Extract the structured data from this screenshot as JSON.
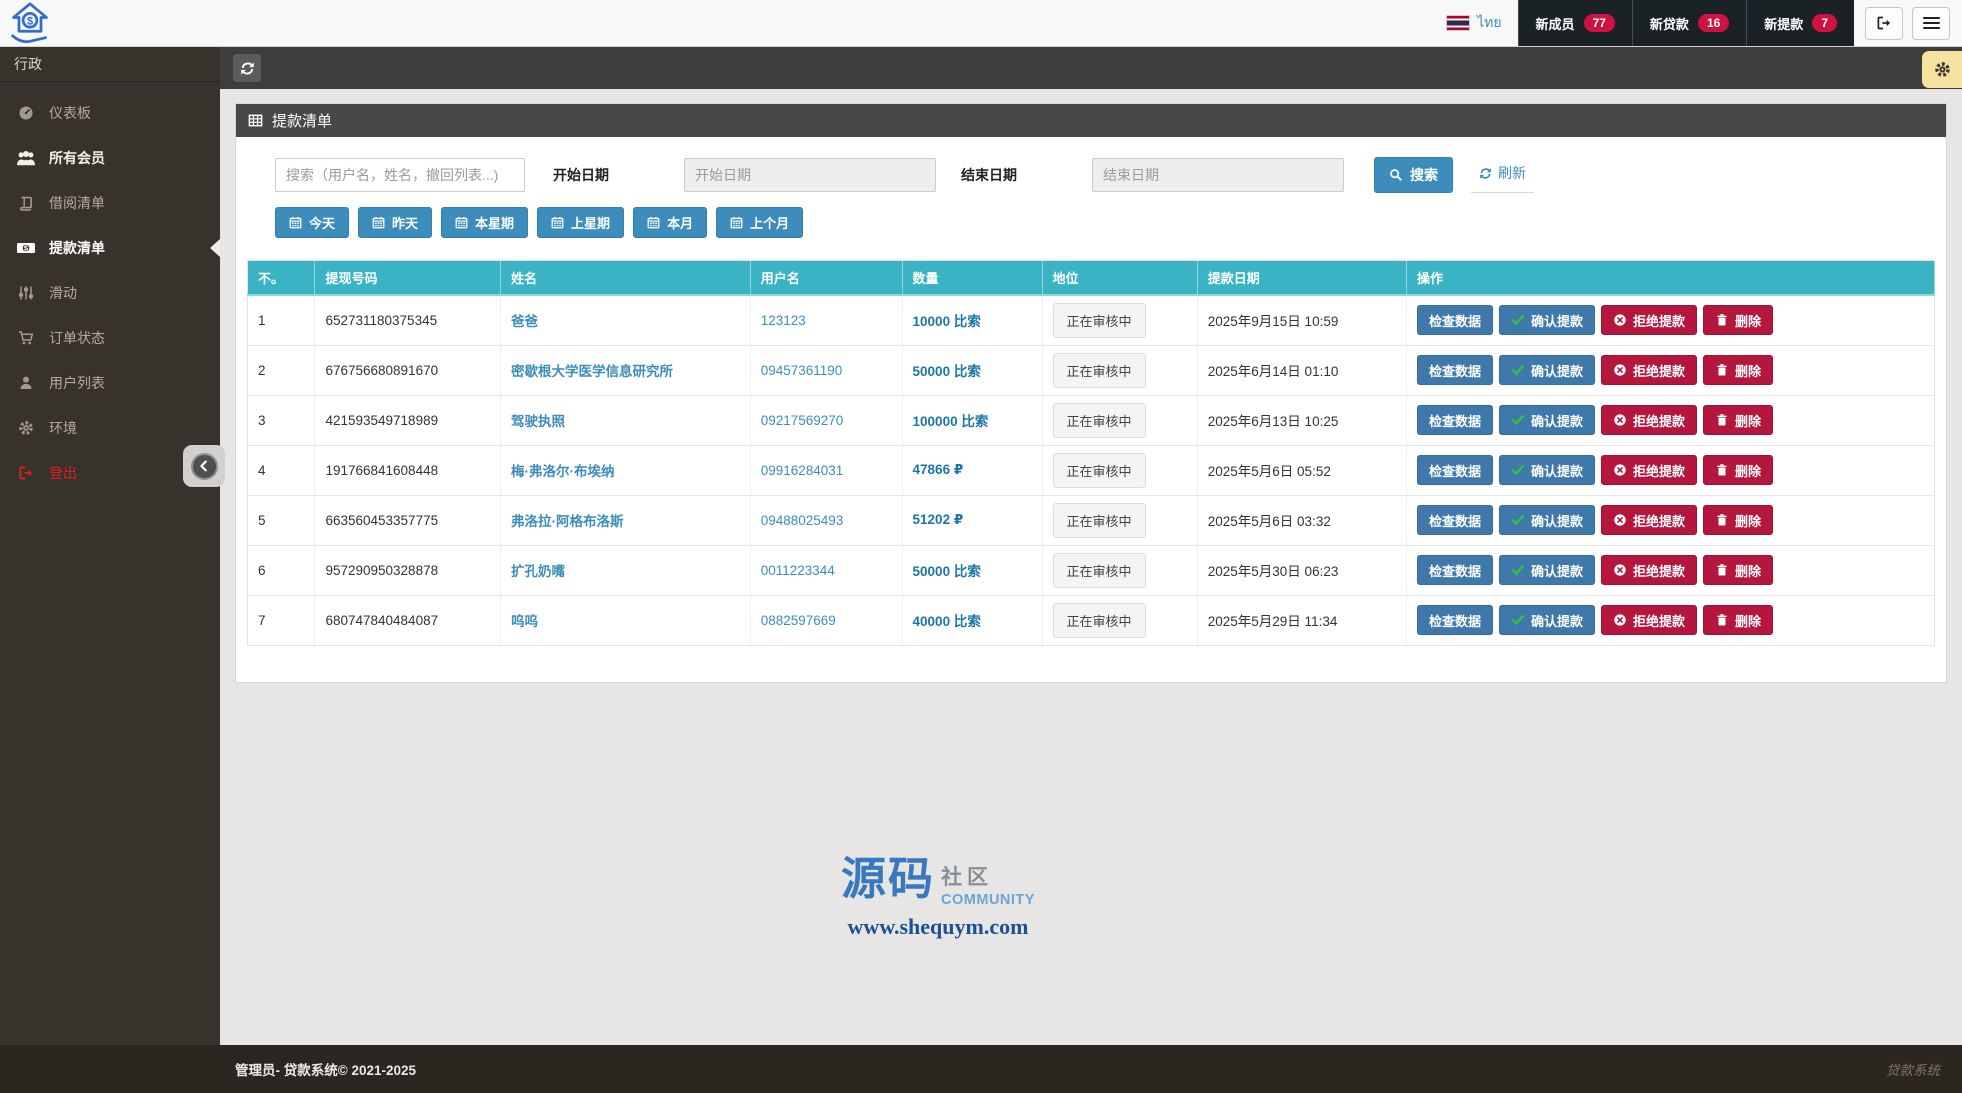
{
  "topbar": {
    "lang": "ไทย",
    "nav": [
      {
        "label": "新成员",
        "count": "77"
      },
      {
        "label": "新贷款",
        "count": "16"
      },
      {
        "label": "新提款",
        "count": "7"
      }
    ]
  },
  "sidebar": {
    "header": "行政",
    "items": [
      {
        "label": "仪表板",
        "icon": "dashboard",
        "cls": ""
      },
      {
        "label": "所有会员",
        "icon": "users",
        "cls": "bright"
      },
      {
        "label": "借阅清单",
        "icon": "book",
        "cls": ""
      },
      {
        "label": "提款清单",
        "icon": "money",
        "cls": "active"
      },
      {
        "label": "滑动",
        "icon": "sliders",
        "cls": ""
      },
      {
        "label": "订单状态",
        "icon": "cart",
        "cls": ""
      },
      {
        "label": "用户列表",
        "icon": "user",
        "cls": ""
      },
      {
        "label": "环境",
        "icon": "gear",
        "cls": ""
      },
      {
        "label": "登出",
        "icon": "signout",
        "cls": "logout"
      }
    ]
  },
  "panel": {
    "title": "提款清单"
  },
  "filters": {
    "search_placeholder": "搜索（用户名，姓名，撤回列表...)",
    "start_label": "开始日期",
    "start_placeholder": "开始日期",
    "end_label": "结束日期",
    "end_placeholder": "结束日期",
    "search_button": "搜索",
    "refresh_button": "刷新",
    "quick": [
      "今天",
      "昨天",
      "本星期",
      "上星期",
      "本月",
      "上个月"
    ]
  },
  "table": {
    "headers": [
      "不。",
      "提现号码",
      "姓名",
      "用户名",
      "数量",
      "地位",
      "提款日期",
      "操作"
    ],
    "actions": {
      "check": "检查数据",
      "confirm": "确认提款",
      "reject": "拒绝提款",
      "del": "删除"
    },
    "rows": [
      {
        "no": "1",
        "code": "652731180375345",
        "name": "爸爸",
        "username": "123123",
        "amount": "10000 比索",
        "status": "正在审核中",
        "date": "2025年9月15日 10:59"
      },
      {
        "no": "2",
        "code": "676756680891670",
        "name": "密歇根大学医学信息研究所",
        "username": "09457361190",
        "amount": "50000 比索",
        "status": "正在审核中",
        "date": "2025年6月14日 01:10"
      },
      {
        "no": "3",
        "code": "421593549718989",
        "name": "驾驶执照",
        "username": "09217569270",
        "amount": "100000 比索",
        "status": "正在审核中",
        "date": "2025年6月13日 10:25"
      },
      {
        "no": "4",
        "code": "191766841608448",
        "name": "梅·弗洛尔·布埃纳",
        "username": "09916284031",
        "amount": "47866 ₽",
        "status": "正在审核中",
        "date": "2025年5月6日 05:52"
      },
      {
        "no": "5",
        "code": "663560453357775",
        "name": "弗洛拉·阿格布洛斯",
        "username": "09488025493",
        "amount": "51202 ₽",
        "status": "正在审核中",
        "date": "2025年5月6日 03:32"
      },
      {
        "no": "6",
        "code": "957290950328878",
        "name": "扩孔奶嘴",
        "username": "0011223344",
        "amount": "50000 比索",
        "status": "正在审核中",
        "date": "2025年5月30日 06:23"
      },
      {
        "no": "7",
        "code": "680747840484087",
        "name": "呜呜",
        "username": "0882597669",
        "amount": "40000 比索",
        "status": "正在审核中",
        "date": "2025年5月29日 11:34"
      }
    ]
  },
  "watermark": {
    "cn_big": "源码",
    "cn_small": "社区",
    "en": "COMMUNITY",
    "url": "www.shequym.com"
  },
  "footer": {
    "left": "管理员- 贷款系统© 2021-2025",
    "right": "贷款系统"
  },
  "colors": {
    "teal_header": "#3ab4c4",
    "primary_blue": "#3c8dbc",
    "action_blue": "#3f79ab",
    "crimson": "#b4163e",
    "badge_red": "#cf1240",
    "sidebar_bg": "#37322c"
  }
}
